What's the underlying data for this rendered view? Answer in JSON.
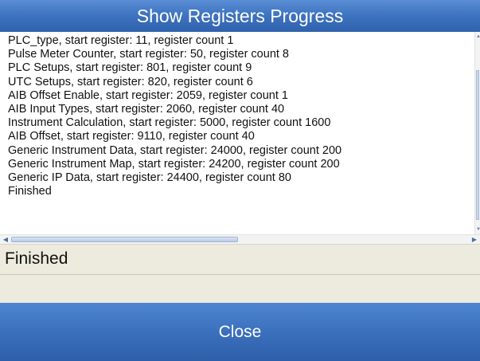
{
  "dialog": {
    "title": "Show Registers Progress"
  },
  "log": {
    "lines": [
      "PLC_type, start register: 11, register count 1",
      "Pulse Meter Counter, start register: 50, register count 8",
      "PLC Setups, start register: 801, register count 9",
      "UTC Setups, start register: 820, register count 6",
      "AIB Offset Enable, start register: 2059, register count 1",
      "AIB Input Types, start register: 2060, register count 40",
      "Instrument Calculation, start register: 5000, register count 1600",
      "AIB Offset, start register: 9110, register count 40",
      "Generic Instrument Data, start register: 24000, register count 200",
      "Generic Instrument Map, start register: 24200, register count 200",
      "Generic IP Data, start register: 24400, register count 80",
      "Finished"
    ]
  },
  "status": {
    "text": "Finished"
  },
  "footer": {
    "close_label": "Close"
  },
  "icons": {
    "scroll_left": "arrow-left-icon",
    "scroll_right": "arrow-right-icon",
    "scroll_up": "arrow-up-icon",
    "scroll_down": "arrow-down-icon"
  },
  "colors": {
    "title_bar": "#3f74c0",
    "close_button": "#3b70bd",
    "status_background": "#ecebdd"
  }
}
